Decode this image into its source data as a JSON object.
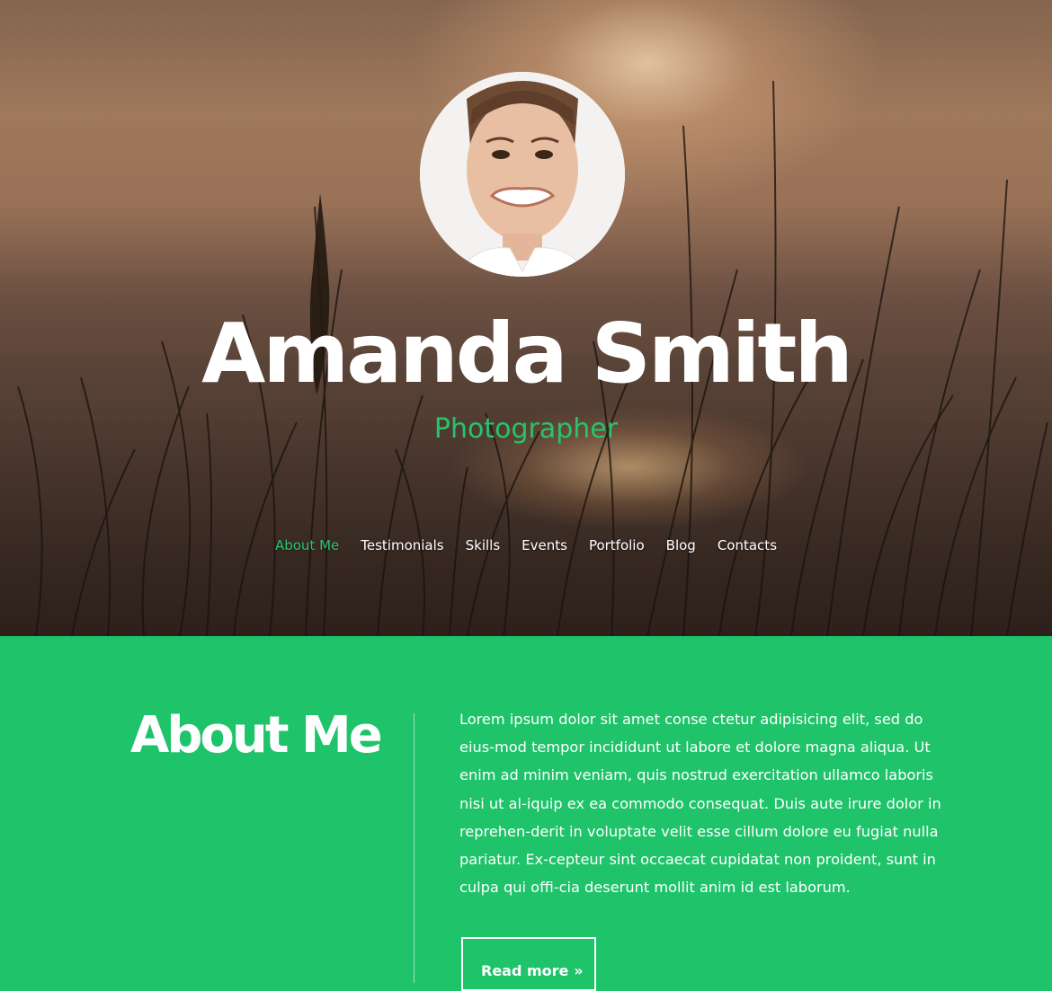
{
  "profile": {
    "name": "Amanda Smith",
    "role": "Photographer"
  },
  "nav": {
    "items": [
      "About Me",
      "Testimonials",
      "Skills",
      "Events",
      "Portfolio",
      "Blog",
      "Contacts"
    ],
    "active_index": 0
  },
  "about": {
    "heading": "About Me",
    "body": "Lorem ipsum dolor sit amet conse ctetur adipisicing elit, sed do eius-mod tempor incididunt ut labore et dolore magna aliqua. Ut enim ad minim veniam, quis nostrud exercitation ullamco laboris nisi ut al-iquip ex ea commodo consequat. Duis aute irure dolor in reprehen-derit in voluptate velit esse cillum dolore eu fugiat nulla pariatur. Ex-cepteur sint occaecat cupidatat non proident, sunt in culpa qui offi-cia deserunt mollit anim id est laborum.",
    "button_label": "Read more",
    "button_icon": "double-chevron-right-icon"
  },
  "colors": {
    "accent": "#27c46c",
    "section_bg": "#1ec36a",
    "text": "#ffffff"
  }
}
